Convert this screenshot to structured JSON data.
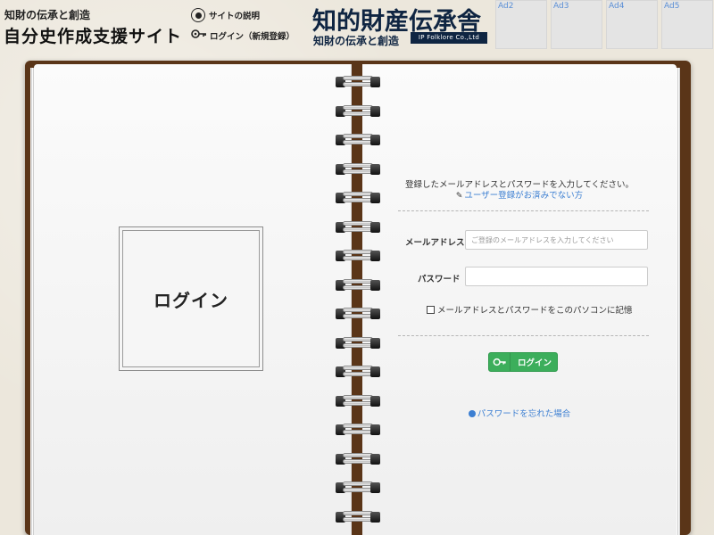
{
  "header": {
    "subtitle": "知財の伝承と創造",
    "title": "自分史作成支援サイト",
    "nav": [
      {
        "label": "サイトの説明",
        "icon": "info-circle-icon"
      },
      {
        "label": "ログイン（新規登録）",
        "icon": "key-icon"
      }
    ],
    "logo": {
      "main": "知的財産伝承舎",
      "sub": "知財の伝承と創造",
      "badge": "IP Folklore Co.,Ltd"
    },
    "ads": [
      "Ad2",
      "Ad3",
      "Ad4",
      "Ad5"
    ]
  },
  "left_page": {
    "heading": "ログイン"
  },
  "right_page": {
    "instruction": "登録したメールアドレスとパスワードを入力してください。",
    "register_link": "ユーザー登録がお済みでない方",
    "email_label": "メールアドレス",
    "email_placeholder": "ご登録のメールアドレスを入力してください",
    "email_value": "",
    "password_label": "パスワード",
    "password_value": "",
    "remember_label": "メールアドレスとパスワードをこのパソコンに記憶",
    "remember_checked": false,
    "login_button": "ログイン",
    "forgot_link": "パスワードを忘れた場合"
  },
  "colors": {
    "notebook_cover": "#5a3518",
    "login_button": "#3cae5b",
    "link": "#3c7fd2",
    "logo": "#0f2542"
  }
}
